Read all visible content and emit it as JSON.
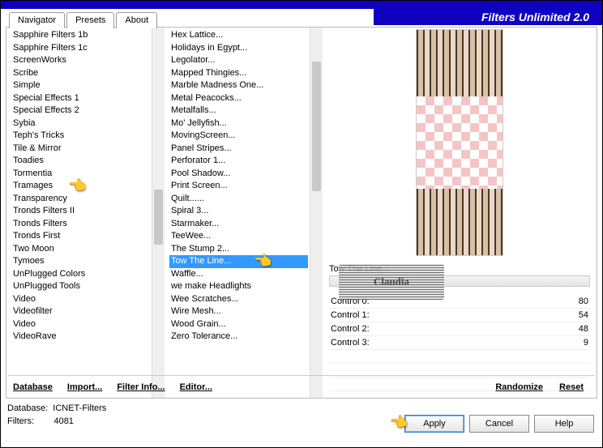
{
  "title": "Filters Unlimited 2.0",
  "tabs": [
    "Navigator",
    "Presets",
    "About"
  ],
  "active_tab": 0,
  "categories": [
    "Sapphire Filters 1b",
    "Sapphire Filters 1c",
    "ScreenWorks",
    "Scribe",
    "Simple",
    "Special Effects 1",
    "Special Effects 2",
    "Sybia",
    "Teph's Tricks",
    "Tile & Mirror",
    "Toadies",
    "Tormentia",
    "Tramages",
    "Transparency",
    "Tronds Filters II",
    "Tronds Filters",
    "Tronds First",
    "Two Moon",
    "Tymoes",
    "UnPlugged Colors",
    "UnPlugged Tools",
    "Video",
    "Videofilter",
    "Video",
    "VideoRave"
  ],
  "category_selected": 12,
  "filters": [
    "Hex Lattice...",
    "Holidays in Egypt...",
    "Legolator...",
    "Mapped Thingies...",
    "Marble Madness One...",
    "Metal Peacocks...",
    "Metalfalls...",
    "Mo' Jellyfish...",
    "MovingScreen...",
    "Panel Stripes...",
    "Perforator 1...",
    "Pool Shadow...",
    "Print Screen...",
    "Quilt......",
    "Spiral 3...",
    "Starmaker...",
    "TeeWee...",
    "The Stump 2...",
    "Tow The Line...",
    "Waffle...",
    "we make Headlights",
    "Wee Scratches...",
    "Wire Mesh...",
    "Wood Grain...",
    "Zero Tolerance..."
  ],
  "filter_selected": 18,
  "watermark": "Claudia",
  "selected_filter_label": "Tow The Line...",
  "controls": [
    {
      "label": "Control 0:",
      "value": 80
    },
    {
      "label": "Control 1:",
      "value": 54
    },
    {
      "label": "Control 2:",
      "value": 48
    },
    {
      "label": "Control 3:",
      "value": 9
    }
  ],
  "bottom_links": {
    "database": "Database",
    "import": "Import...",
    "filter_info": "Filter Info...",
    "editor": "Editor...",
    "randomize": "Randomize",
    "reset": "Reset"
  },
  "footer_info": {
    "db_label": "Database:",
    "db_value": "ICNET-Filters",
    "filters_label": "Filters:",
    "filters_value": "4081"
  },
  "buttons": {
    "apply": "Apply",
    "cancel": "Cancel",
    "help": "Help"
  }
}
